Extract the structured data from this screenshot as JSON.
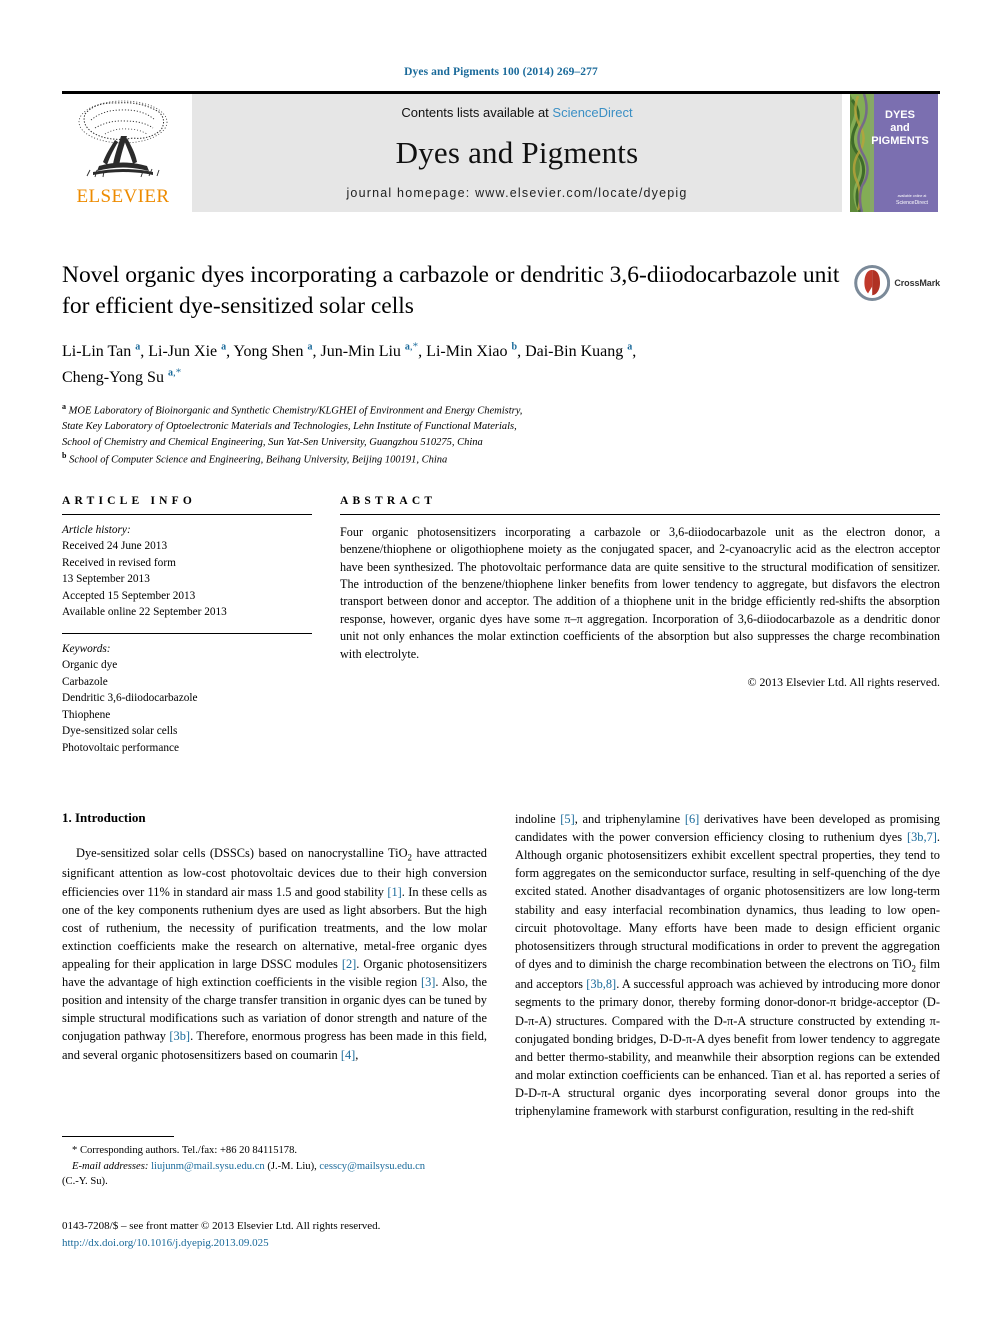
{
  "running_citation": "Dyes and Pigments 100 (2014) 269–277",
  "masthead": {
    "publisher_name": "ELSEVIER",
    "contents_prefix": "Contents lists available at ",
    "contents_link": "ScienceDirect",
    "journal_title": "Dyes and Pigments",
    "homepage_line": "journal homepage: www.elsevier.com/locate/dyepig",
    "cover_title_line1": "DYES",
    "cover_title_line2": "and",
    "cover_title_line3": "PIGMENTS",
    "cover_footer": "ScienceDirect"
  },
  "crossmark": {
    "label": "CrossMark"
  },
  "article": {
    "title": "Novel organic dyes incorporating a carbazole or dendritic 3,6-diiodocarbazole unit for efficient dye-sensitized solar cells",
    "authors_line1": "Li-Lin Tan a, Li-Jun Xie a, Yong Shen a, Jun-Min Liu a,*, Li-Min Xiao b, Dai-Bin Kuang a,",
    "authors_line2": "Cheng-Yong Su a,*",
    "affiliation_a_line1": "MOE Laboratory of Bioinorganic and Synthetic Chemistry/KLGHEI of Environment and Energy Chemistry,",
    "affiliation_a_line2": "State Key Laboratory of Optoelectronic Materials and Technologies, Lehn Institute of Functional Materials,",
    "affiliation_a_line3": "School of Chemistry and Chemical Engineering, Sun Yat-Sen University, Guangzhou 510275, China",
    "affiliation_b_line1": "School of Computer Science and Engineering, Beihang University, Beijing 100191, China"
  },
  "article_info": {
    "heading": "ARTICLE INFO",
    "history_label": "Article history:",
    "history": [
      "Received 24 June 2013",
      "Received in revised form",
      "13 September 2013",
      "Accepted 15 September 2013",
      "Available online 22 September 2013"
    ],
    "keywords_label": "Keywords:",
    "keywords": [
      "Organic dye",
      "Carbazole",
      "Dendritic 3,6-diiodocarbazole",
      "Thiophene",
      "Dye-sensitized solar cells",
      "Photovoltaic performance"
    ]
  },
  "abstract": {
    "heading": "ABSTRACT",
    "body": "Four organic photosensitizers incorporating a carbazole or 3,6-diiodocarbazole unit as the electron donor, a benzene/thiophene or oligothiophene moiety as the conjugated spacer, and 2-cyanoacrylic acid as the electron acceptor have been synthesized. The photovoltaic performance data are quite sensitive to the structural modification of sensitizer. The introduction of the benzene/thiophene linker benefits from lower tendency to aggregate, but disfavors the electron transport between donor and acceptor. The addition of a thiophene unit in the bridge efficiently red-shifts the absorption response, however, organic dyes have some π–π aggregation. Incorporation of 3,6-diiodocarbazole as a dendritic donor unit not only enhances the molar extinction coefficients of the absorption but also suppresses the charge recombination with electrolyte.",
    "copyright": "© 2013 Elsevier Ltd. All rights reserved."
  },
  "introduction": {
    "section_title": "1. Introduction",
    "left_paragraph_part1": "Dye-sensitized solar cells (DSSCs) based on nanocrystalline TiO",
    "left_paragraph_sub": "2",
    "left_paragraph_part2": " have attracted significant attention as low-cost photovoltaic devices due to their high conversion efficiencies over 11% in standard air mass 1.5 and good stability ",
    "ref_1": "[1]",
    "left_paragraph_part3": ". In these cells as one of the key components ruthenium dyes are used as light absorbers. But the high cost of ruthenium, the necessity of purification treatments, and the low molar extinction coefficients make the research on alternative, metal-free organic dyes appealing for their application in large DSSC modules ",
    "ref_2": "[2]",
    "left_paragraph_part4": ". Organic photosensitizers have the advantage of high extinction coefficients in the visible region ",
    "ref_3": "[3]",
    "left_paragraph_part5": ". Also, the position and intensity of the charge transfer transition in organic dyes can be tuned by simple structural modifications such as variation of donor strength and nature of the conjugation pathway ",
    "ref_3b": "[3b]",
    "left_paragraph_part6": ". Therefore, enormous progress has been made in this field, and several organic photosensitizers based on coumarin ",
    "ref_4": "[4]",
    "left_paragraph_part7": ",",
    "right_part1": "indoline ",
    "ref_5": "[5]",
    "right_part2": ", and triphenylamine ",
    "ref_6": "[6]",
    "right_part3": " derivatives have been developed as promising candidates with the power conversion efficiency closing to ruthenium dyes ",
    "ref_3b7": "[3b,7]",
    "right_part4": ". Although organic photosensitizers exhibit excellent spectral properties, they tend to form aggregates on the semiconductor surface, resulting in self-quenching of the dye excited stated. Another disadvantages of organic photosensitizers are low long-term stability and easy interfacial recombination dynamics, thus leading to low open-circuit photovoltage. Many efforts have been made to design efficient organic photosensitizers through structural modifications in order to prevent the aggregation of dyes and to diminish the charge recombination between the electrons on TiO",
    "right_sub": "2",
    "right_part5": " film and acceptors ",
    "ref_3b8": "[3b,8]",
    "right_part6": ". A successful approach was achieved by introducing more donor segments to the primary donor, thereby forming donor-donor-π bridge-acceptor (D-D-π-A) structures. Compared with the D-π-A structure constructed by extending π-conjugated bonding bridges, D-D-π-A dyes benefit from lower tendency to aggregate and better thermo-stability, and meanwhile their absorption regions can be extended and molar extinction coefficients can be enhanced. Tian et al. has reported a series of D-D-π-A structural organic dyes incorporating several donor groups into the triphenylamine framework with starburst configuration, resulting in the red-shift"
  },
  "footnotes": {
    "corresponding": "* Corresponding authors. Tel./fax: +86 20 84115178.",
    "email_label": "E-mail addresses:",
    "email_1": "liujunm@mail.sysu.edu.cn",
    "email_1_owner": " (J.-M. Liu), ",
    "email_2": "cesscy@mailsysu.edu.cn",
    "email_2_owner": "(C.-Y. Su)."
  },
  "issn": {
    "line": "0143-7208/$ – see front matter © 2013 Elsevier Ltd. All rights reserved.",
    "doi": "http://dx.doi.org/10.1016/j.dyepig.2013.09.025"
  },
  "colors": {
    "link_blue": "#1a6a9a",
    "sciencedirect_blue": "#3a8fc4",
    "elsevier_orange": "#ED8B00",
    "band_grey": "#e6e6e6",
    "cover_purple": "#7b6fb0"
  }
}
